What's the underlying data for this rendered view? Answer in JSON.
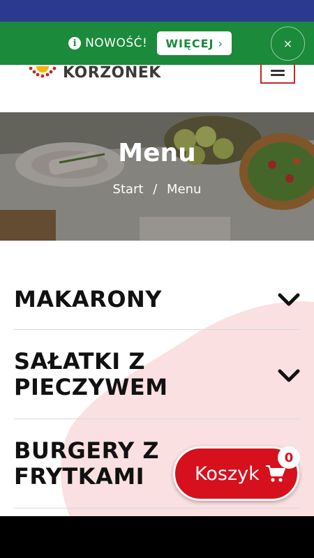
{
  "promo": {
    "text": "NOWOŚĆ!",
    "more_label": "WIĘCEJ",
    "close_symbol": "×",
    "info_symbol": "i"
  },
  "header": {
    "logo_text": "KORZONEK"
  },
  "hero": {
    "title": "Menu",
    "breadcrumb": [
      "Start",
      "Menu"
    ],
    "breadcrumb_separator": "/"
  },
  "categories": [
    {
      "label": "MAKARONY"
    },
    {
      "label": "SAŁATKI Z PIECZYWEM"
    },
    {
      "label": "BURGERY Z FRYTKAMI"
    }
  ],
  "cart": {
    "label": "Koszyk",
    "count": "0"
  },
  "colors": {
    "promo_bg": "#1b8a3b",
    "status_bar": "#2b3a8f",
    "accent_red": "#d7101d",
    "blob_pink": "#fae0e1"
  },
  "icons": {
    "info": "info-icon",
    "close": "close-icon",
    "menu": "hamburger-menu-icon",
    "chevron": "chevron-down-icon",
    "cart": "shopping-cart-icon"
  }
}
